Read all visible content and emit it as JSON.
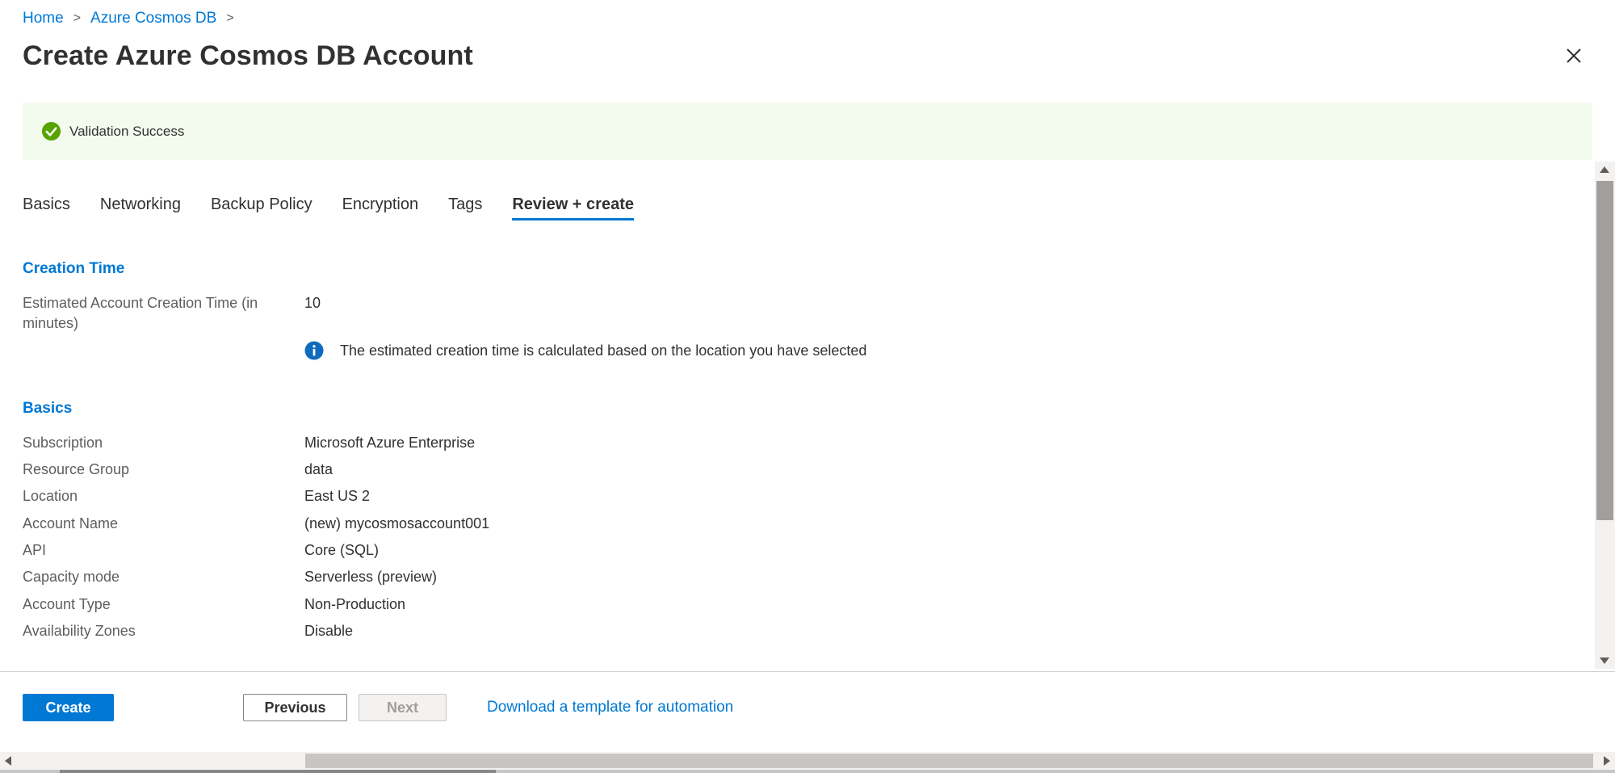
{
  "breadcrumb": {
    "home": "Home",
    "service": "Azure Cosmos DB",
    "separator": ">"
  },
  "page": {
    "title": "Create Azure Cosmos DB Account"
  },
  "validation": {
    "message": "Validation Success",
    "color": "#57a300"
  },
  "tabs": [
    {
      "label": "Basics"
    },
    {
      "label": "Networking"
    },
    {
      "label": "Backup Policy"
    },
    {
      "label": "Encryption"
    },
    {
      "label": "Tags"
    },
    {
      "label": "Review + create",
      "active": true
    }
  ],
  "creation_time": {
    "heading": "Creation Time",
    "label_line1": "Estimated Account Creation Time (in",
    "label_line2": "minutes)",
    "value": "10",
    "info": "The estimated creation time is calculated based on the location you have selected"
  },
  "basics": {
    "heading": "Basics",
    "rows": [
      {
        "label": "Subscription",
        "value": "Microsoft Azure Enterprise"
      },
      {
        "label": "Resource Group",
        "value": "data"
      },
      {
        "label": "Location",
        "value": "East US 2"
      },
      {
        "label": "Account Name",
        "value": "(new) mycosmosaccount001"
      },
      {
        "label": "API",
        "value": "Core (SQL)"
      },
      {
        "label": "Capacity mode",
        "value": "Serverless (preview)"
      },
      {
        "label": "Account Type",
        "value": "Non-Production"
      },
      {
        "label": "Availability Zones",
        "value": "Disable"
      }
    ]
  },
  "footer": {
    "create_label": "Create",
    "previous_label": "Previous",
    "next_label": "Next",
    "template_link": "Download a template for automation"
  },
  "colors": {
    "accent": "#0078d4",
    "success_bg": "#f3fbef"
  }
}
